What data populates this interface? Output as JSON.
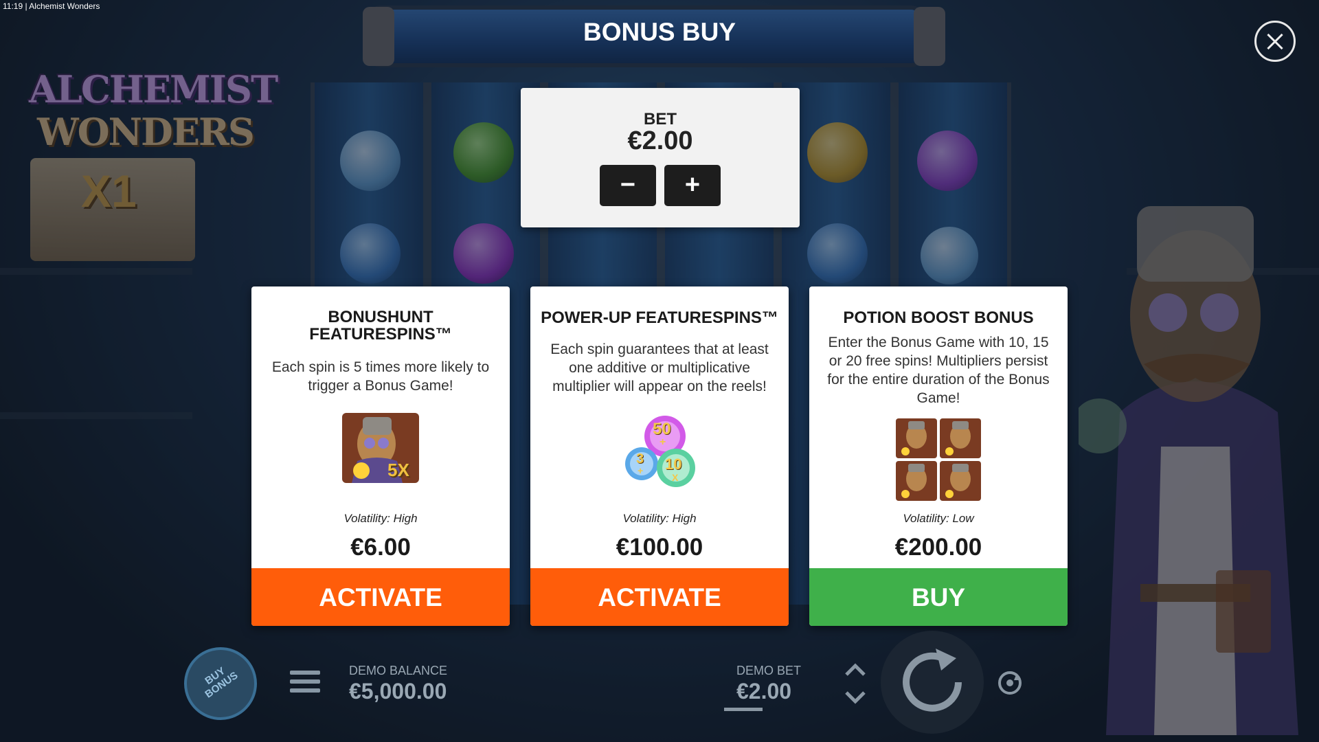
{
  "status_bar": {
    "time": "11:19",
    "separator": "|",
    "app_title": "Alchemist Wonders"
  },
  "logo": {
    "line1": "ALCHEMIST",
    "line2": "WONDERS",
    "multiplier": "X1"
  },
  "dialog": {
    "title": "BONUS BUY",
    "close_icon": "close-icon",
    "bet": {
      "label": "BET",
      "value": "€2.00",
      "decrease_label": "−",
      "increase_label": "+"
    },
    "offers": [
      {
        "title": "BONUSHUNT FEATURESPINS™",
        "description": "Each spin is 5 times more likely to trigger a Bonus Game!",
        "icon": "alchemist-5x-icon",
        "icon_text": "5X",
        "volatility": "Volatility: High",
        "price": "€6.00",
        "action_label": "ACTIVATE",
        "action_color": "#ff5d0a"
      },
      {
        "title": "POWER-UP FEATURESPINS™",
        "description": "Each spin guarantees that at least one additive or multiplicative multiplier will appear on the reels!",
        "icon": "multiplier-orbs-icon",
        "icon_texts": [
          "50",
          "+",
          "3",
          "+",
          "10",
          "X"
        ],
        "volatility": "Volatility: High",
        "price": "€100.00",
        "action_label": "ACTIVATE",
        "action_color": "#ff5d0a"
      },
      {
        "title": "POTION BOOST BONUS",
        "description": "Enter the Bonus Game with 10, 15 or 20 free spins! Multipliers persist for the entire duration of the Bonus Game!",
        "icon": "alchemist-grid-icon",
        "volatility": "Volatility: Low",
        "price": "€200.00",
        "action_label": "BUY",
        "action_color": "#3fb04a"
      }
    ]
  },
  "bottom_bar": {
    "buy_bonus_line1": "BUY",
    "buy_bonus_line2": "BONUS",
    "balance_label": "DEMO BALANCE",
    "balance_value": "€5,000.00",
    "bet_label": "DEMO BET",
    "bet_value": "€2.00"
  }
}
